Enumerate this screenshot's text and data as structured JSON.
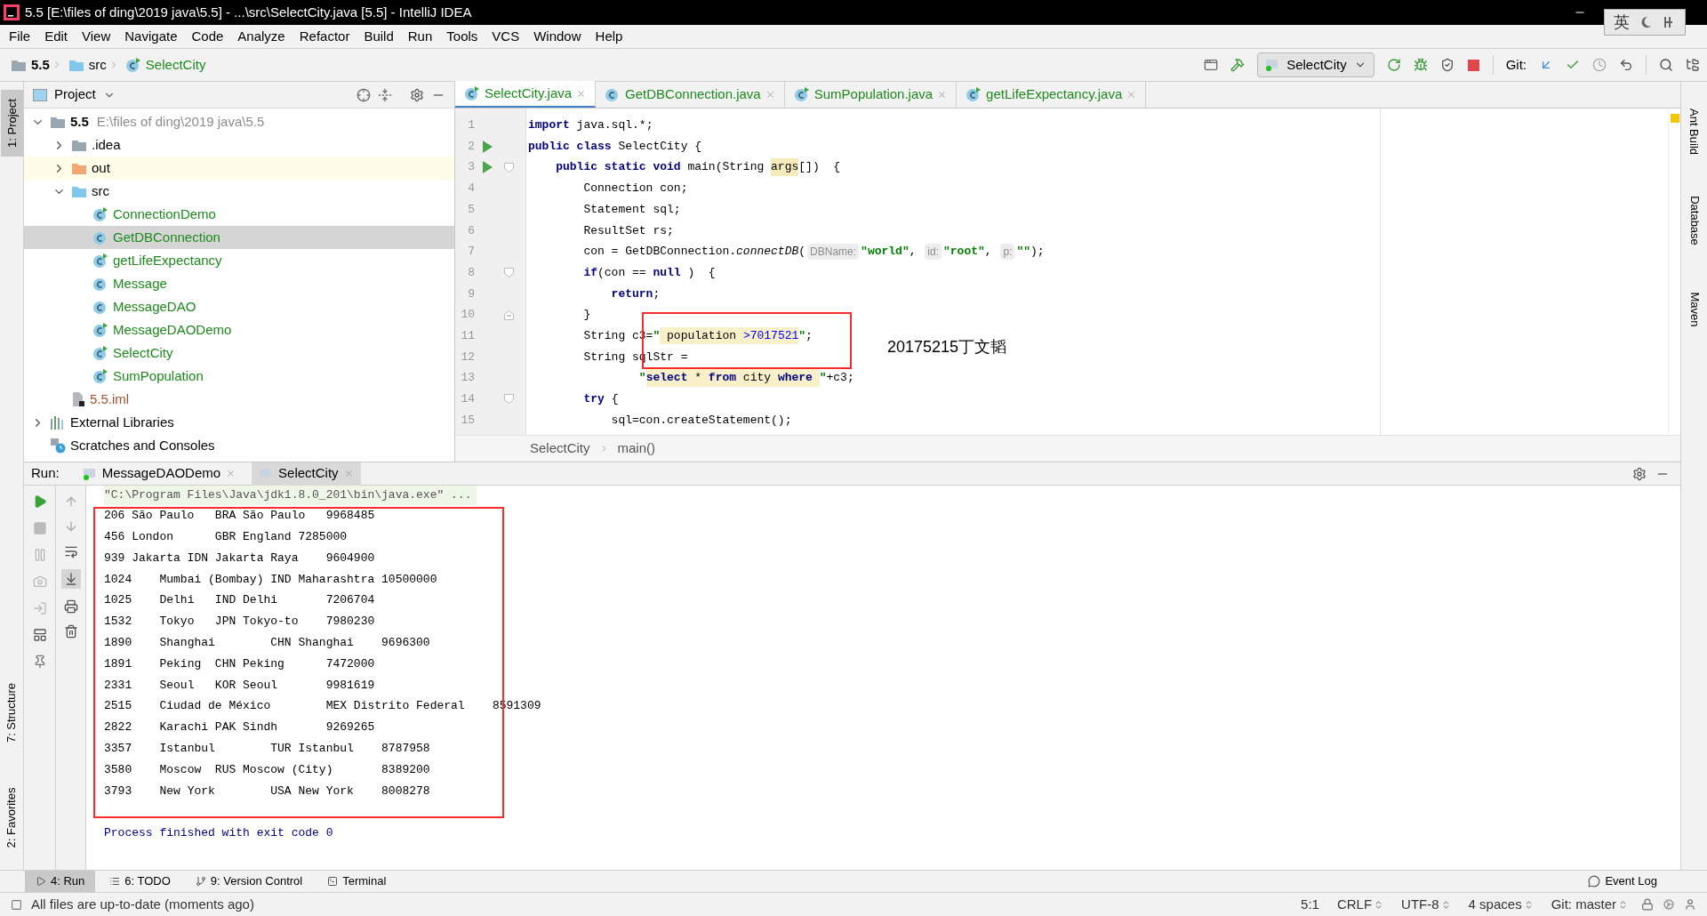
{
  "window": {
    "title": "5.5 [E:\\files of ding\\2019 java\\5.5] - ...\\src\\SelectCity.java [5.5] - IntelliJ IDEA",
    "ime_label": "英"
  },
  "menu": [
    "File",
    "Edit",
    "View",
    "Navigate",
    "Code",
    "Analyze",
    "Refactor",
    "Build",
    "Run",
    "Tools",
    "VCS",
    "Window",
    "Help"
  ],
  "navbar": [
    {
      "label": "5.5",
      "kind": "project"
    },
    {
      "label": "src",
      "kind": "folder"
    },
    {
      "label": "SelectCity",
      "kind": "class"
    }
  ],
  "toolbar": {
    "run_config": "SelectCity",
    "git_label": "Git:"
  },
  "left_tool_tabs": [
    {
      "label": "1: Project",
      "selected": true,
      "kind": "top"
    },
    {
      "label": "7: Structure",
      "selected": false,
      "kind": "bottom"
    },
    {
      "label": "2: Favorites",
      "selected": false,
      "kind": "bottom"
    }
  ],
  "right_tool_tabs": [
    "Ant Build",
    "Database",
    "Maven"
  ],
  "project_panel": {
    "title": "Project",
    "tree": [
      {
        "label": "5.5",
        "path": "E:\\files of ding\\2019 java\\5.5",
        "kind": "project",
        "expanded": true,
        "selected": false,
        "children": [
          {
            "label": ".idea",
            "kind": "folder",
            "expanded": false,
            "selected": false
          },
          {
            "label": "out",
            "kind": "excluded-folder",
            "expanded": false,
            "selected": false
          },
          {
            "label": "src",
            "kind": "source-folder",
            "expanded": true,
            "selected": false,
            "children": [
              {
                "label": "ConnectionDemo",
                "kind": "runnable-class",
                "selected": false
              },
              {
                "label": "GetDBConnection",
                "kind": "class",
                "selected": true
              },
              {
                "label": "getLifeExpectancy",
                "kind": "runnable-class",
                "selected": false
              },
              {
                "label": "Message",
                "kind": "class",
                "selected": false
              },
              {
                "label": "MessageDAO",
                "kind": "class",
                "selected": false
              },
              {
                "label": "MessageDAODemo",
                "kind": "runnable-class",
                "selected": false
              },
              {
                "label": "SelectCity",
                "kind": "runnable-class",
                "selected": false
              },
              {
                "label": "SumPopulation",
                "kind": "runnable-class",
                "selected": false
              }
            ]
          },
          {
            "label": "5.5.iml",
            "kind": "iml",
            "selected": false
          }
        ]
      },
      {
        "label": "External Libraries",
        "kind": "libraries",
        "expanded": false,
        "selected": false
      },
      {
        "label": "Scratches and Consoles",
        "kind": "scratches",
        "selected": false
      }
    ]
  },
  "editor": {
    "tabs": [
      {
        "label": "SelectCity.java",
        "kind": "runnable-class",
        "selected": true
      },
      {
        "label": "GetDBConnection.java",
        "kind": "class",
        "selected": false
      },
      {
        "label": "SumPopulation.java",
        "kind": "runnable-class",
        "selected": false
      },
      {
        "label": "getLifeExpectancy.java",
        "kind": "runnable-class",
        "selected": false
      }
    ],
    "lines": [
      {
        "number": "1",
        "run": false,
        "kind": "plain",
        "tokens": [
          {
            "kind": "kw",
            "text": "import"
          },
          {
            "kind": "plain",
            "text": " java.sql.*;"
          }
        ]
      },
      {
        "number": "2",
        "run": true,
        "kind": "plain",
        "tokens": [
          {
            "kind": "kw",
            "text": "public class"
          },
          {
            "kind": "plain",
            "text": " SelectCity {"
          }
        ]
      },
      {
        "number": "3",
        "run": true,
        "kind": "fold-start",
        "tokens": [
          {
            "kind": "kw",
            "text": "    public static void"
          },
          {
            "kind": "plain",
            "text": " main(String "
          },
          {
            "kind": "hl",
            "text": "args"
          },
          {
            "kind": "plain",
            "text": "[])  {"
          }
        ]
      },
      {
        "number": "4",
        "run": false,
        "kind": "plain",
        "tokens": [
          {
            "kind": "plain",
            "text": "        Connection con;"
          }
        ]
      },
      {
        "number": "5",
        "run": false,
        "kind": "plain",
        "tokens": [
          {
            "kind": "plain",
            "text": "        Statement sql;"
          }
        ]
      },
      {
        "number": "6",
        "run": false,
        "kind": "plain",
        "tokens": [
          {
            "kind": "plain",
            "text": "        ResultSet rs;"
          }
        ]
      },
      {
        "number": "7",
        "run": false,
        "kind": "plain",
        "tokens": [
          {
            "kind": "plain",
            "text": "        con = GetDBConnection."
          },
          {
            "kind": "italic",
            "text": "connectDB"
          },
          {
            "kind": "plain",
            "text": "("
          },
          {
            "kind": "hint",
            "text": "DBName:"
          },
          {
            "kind": "str",
            "text": "\"world\""
          },
          {
            "kind": "plain",
            "text": ", "
          },
          {
            "kind": "hint",
            "text": "id:"
          },
          {
            "kind": "str",
            "text": "\"root\""
          },
          {
            "kind": "plain",
            "text": ", "
          },
          {
            "kind": "hint",
            "text": "p:"
          },
          {
            "kind": "str",
            "text": "\"\""
          },
          {
            "kind": "plain",
            "text": ");"
          }
        ]
      },
      {
        "number": "8",
        "run": false,
        "kind": "fold-start",
        "tokens": [
          {
            "kind": "kw",
            "text": "        if"
          },
          {
            "kind": "plain",
            "text": "(con == "
          },
          {
            "kind": "kw",
            "text": "null"
          },
          {
            "kind": "plain",
            "text": " )  {"
          }
        ]
      },
      {
        "number": "9",
        "run": false,
        "kind": "plain",
        "tokens": [
          {
            "kind": "kw",
            "text": "            return"
          },
          {
            "kind": "plain",
            "text": ";"
          }
        ]
      },
      {
        "number": "10",
        "run": false,
        "kind": "fold-end",
        "tokens": [
          {
            "kind": "plain",
            "text": "        }"
          }
        ]
      },
      {
        "number": "11",
        "run": false,
        "kind": "plain",
        "tokens": [
          {
            "kind": "plain",
            "text": "        String c3="
          },
          {
            "kind": "str",
            "text": "\""
          },
          {
            "kind": "sql",
            "text": " population "
          },
          {
            "kind": "sqlnum",
            "text": ">7017521"
          },
          {
            "kind": "str",
            "text": "\""
          },
          {
            "kind": "plain",
            "text": ";"
          }
        ]
      },
      {
        "number": "12",
        "run": false,
        "kind": "plain",
        "tokens": [
          {
            "kind": "plain",
            "text": "        String sqlStr ="
          }
        ]
      },
      {
        "number": "13",
        "run": false,
        "kind": "plain",
        "tokens": [
          {
            "kind": "str",
            "text": "                \""
          },
          {
            "kind": "sqlkw",
            "text": "select"
          },
          {
            "kind": "sql",
            "text": " * "
          },
          {
            "kind": "sqlkw",
            "text": "from"
          },
          {
            "kind": "sql",
            "text": " city "
          },
          {
            "kind": "sqlkw",
            "text": "where "
          },
          {
            "kind": "str",
            "text": "\""
          },
          {
            "kind": "plain",
            "text": "+c3;"
          }
        ]
      },
      {
        "number": "14",
        "run": false,
        "kind": "fold-start",
        "tokens": [
          {
            "kind": "kw",
            "text": "        try"
          },
          {
            "kind": "plain",
            "text": " {"
          }
        ]
      },
      {
        "number": "15",
        "run": false,
        "kind": "plain",
        "tokens": [
          {
            "kind": "plain",
            "text": "            sql=con.createStatement();"
          }
        ]
      }
    ],
    "annotation": "20175215丁文韬",
    "breadcrumb": [
      "SelectCity",
      "main()"
    ]
  },
  "run_panel": {
    "label": "Run:",
    "tabs": [
      {
        "label": "MessageDAODemo",
        "selected": false
      },
      {
        "label": "SelectCity",
        "selected": true
      }
    ],
    "command": "\"C:\\Program Files\\Java\\jdk1.8.0_201\\bin\\java.exe\" ...",
    "output": [
      "206 São Paulo\tBRA São Paulo\t9968485",
      "456 London\tGBR England 7285000",
      "939 Jakarta IDN Jakarta Raya\t9604900",
      "1024\tMumbai (Bombay) IND Maharashtra 10500000",
      "1025\tDelhi\tIND Delhi\t7206704",
      "1532\tTokyo\tJPN Tokyo-to\t7980230",
      "1890\tShanghai\tCHN Shanghai\t9696300",
      "1891\tPeking\tCHN Peking\t7472000",
      "2331\tSeoul\tKOR Seoul\t9981619",
      "2515\tCiudad de México\tMEX Distrito Federal\t8591309",
      "2822\tKarachi PAK Sindh\t9269265",
      "3357\tIstanbul\tTUR Istanbul\t8787958",
      "3580\tMoscow\tRUS Moscow (City)\t8389200",
      "3793\tNew York\tUSA New York\t8008278"
    ],
    "exit_message": "Process finished with exit code 0"
  },
  "bottom_tabs": [
    {
      "label": "4: Run",
      "kind": "run",
      "selected": true
    },
    {
      "label": "6: TODO",
      "kind": "todo",
      "selected": false
    },
    {
      "label": "9: Version Control",
      "kind": "vcs",
      "selected": false
    },
    {
      "label": "Terminal",
      "kind": "terminal",
      "selected": false
    }
  ],
  "event_log": "Event Log",
  "status_bar": {
    "message": "All files are up-to-date (moments ago)",
    "items": [
      {
        "text": "5:1",
        "menu": false
      },
      {
        "text": "CRLF",
        "menu": true
      },
      {
        "text": "UTF-8",
        "menu": true
      },
      {
        "text": "4 spaces",
        "menu": true
      },
      {
        "text": "Git: master",
        "menu": true
      }
    ]
  }
}
